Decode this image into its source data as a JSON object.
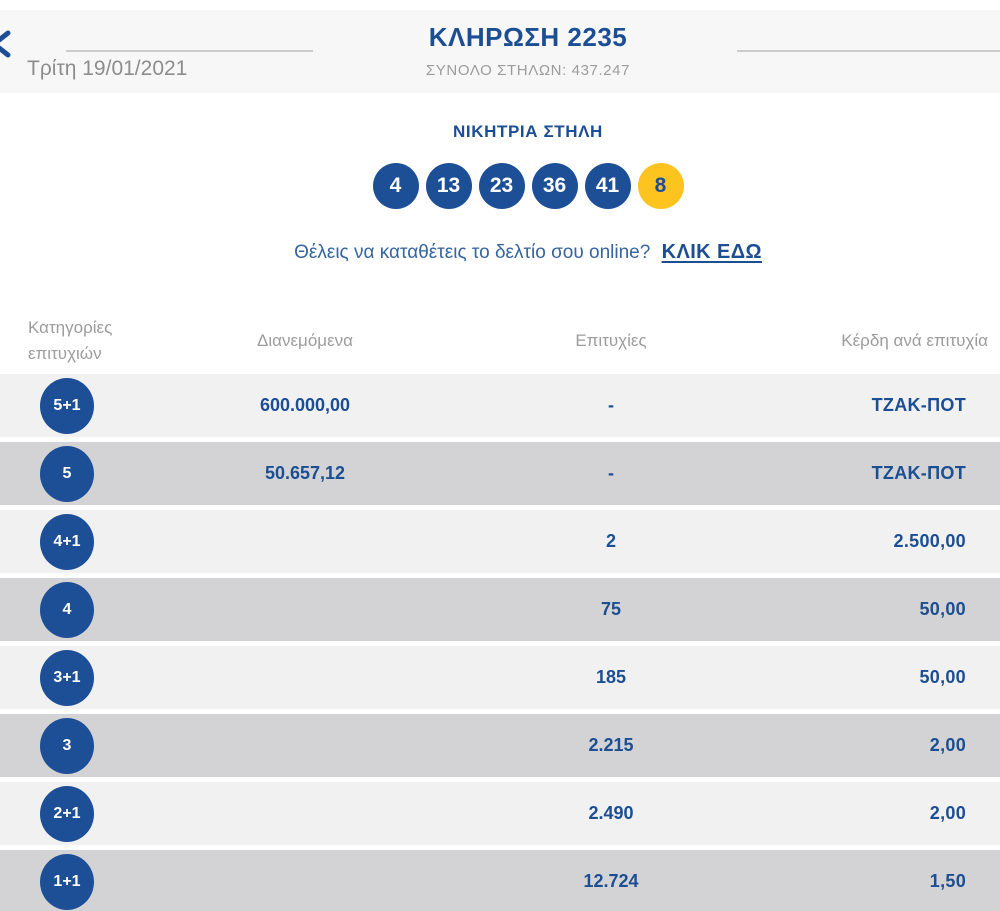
{
  "header": {
    "title": "ΚΛΗΡΩΣΗ 2235",
    "subtitle": "ΣΥΝΟΛΟ ΣΤΗΛΩΝ: 437.247",
    "date": "Τρίτη 19/01/2021",
    "prev_icon": "chevron-left"
  },
  "winning": {
    "title": "ΝΙΚΗΤΡΙΑ ΣΤΗΛΗ",
    "numbers": [
      "4",
      "13",
      "23",
      "36",
      "41"
    ],
    "joker": "8"
  },
  "cta": {
    "question": "Θέλεις να καταθέτεις το δελτίο σου online?",
    "link_label": "ΚΛΙΚ ΕΔΩ"
  },
  "table": {
    "headers": [
      "Κατηγορίες επιτυχιών",
      "Διανεμόμενα",
      "Επιτυχίες",
      "Κέρδη ανά επιτυχία"
    ],
    "rows": [
      {
        "category": "5+1",
        "distributed": "600.000,00",
        "winners": "-",
        "prize": "ΤΖΑΚ-ΠΟΤ"
      },
      {
        "category": "5",
        "distributed": "50.657,12",
        "winners": "-",
        "prize": "ΤΖΑΚ-ΠΟΤ"
      },
      {
        "category": "4+1",
        "distributed": "",
        "winners": "2",
        "prize": "2.500,00"
      },
      {
        "category": "4",
        "distributed": "",
        "winners": "75",
        "prize": "50,00"
      },
      {
        "category": "3+1",
        "distributed": "",
        "winners": "185",
        "prize": "50,00"
      },
      {
        "category": "3",
        "distributed": "",
        "winners": "2.215",
        "prize": "2,00"
      },
      {
        "category": "2+1",
        "distributed": "",
        "winners": "2.490",
        "prize": "2,00"
      },
      {
        "category": "1+1",
        "distributed": "",
        "winners": "12.724",
        "prize": "1,50"
      }
    ]
  },
  "colors": {
    "accent_blue": "#1c4e93",
    "ball_blue": "#1d4f97",
    "joker_yellow": "#fdc41f",
    "row_light": "#f1f1f2",
    "row_dark": "#d3d3d5",
    "band_gray": "#f7f7f8",
    "text_gray": "#9c9c9c"
  }
}
